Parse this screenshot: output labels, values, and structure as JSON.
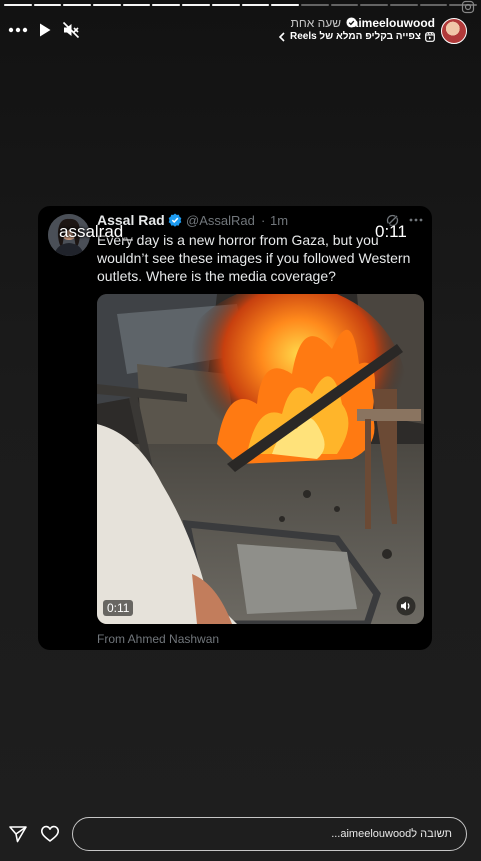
{
  "story": {
    "progress_segments": [
      1,
      1,
      1,
      1,
      1,
      1,
      1,
      1,
      1,
      1,
      0,
      0,
      0,
      0,
      0,
      0
    ],
    "current_segment_progress": 0.0
  },
  "header": {
    "username": "aimeelouwood",
    "time_ago": "שעה אחת",
    "reels_link": "צפייה בקליפ המלא של Reels",
    "icons": [
      "more-icon",
      "play-icon",
      "mute-icon",
      "verified-icon",
      "chevron-left-icon",
      "reels-icon"
    ]
  },
  "tweet": {
    "name": "Assal Rad",
    "handle": "@AssalRad",
    "separator": "·",
    "time_ago": "1m",
    "text": "Every day is a new horror from Gaza, but you wouldn’t see these images if you followed Western outlets. Where is the media coverage?",
    "media": {
      "duration": "0:11",
      "icons": [
        "volume-icon"
      ]
    },
    "attribution": "From Ahmed Nashwan"
  },
  "overlay": {
    "username": "assalrad_",
    "timer": "0:11"
  },
  "footer": {
    "reply_placeholder": "תשובה לaimeelouwood...",
    "icons": [
      "send-icon",
      "heart-icon"
    ]
  },
  "colors": {
    "background": "#1b1b1b",
    "tweet_bg": "#000000",
    "tweet_text": "#e7e9ea",
    "tweet_muted": "#71767b",
    "verified_blue": "#1d9bf0"
  }
}
